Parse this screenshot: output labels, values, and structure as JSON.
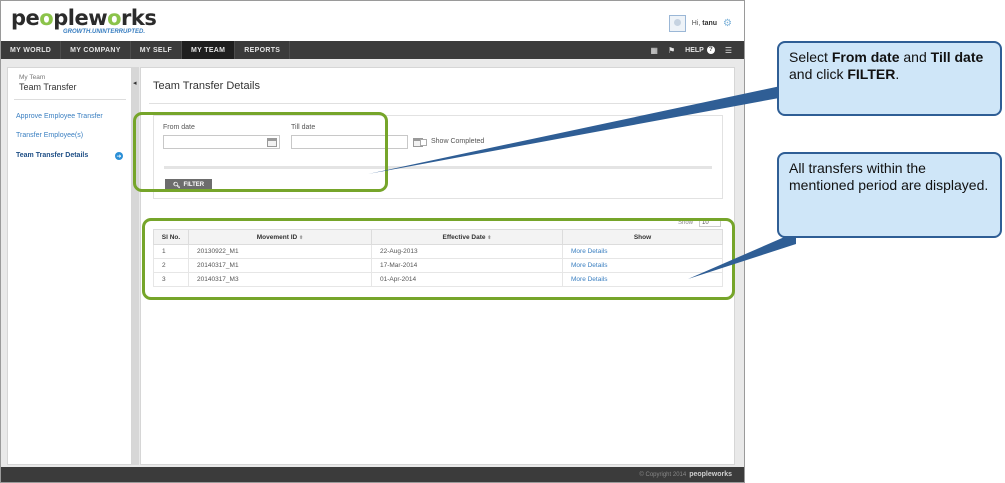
{
  "app": {
    "logo_text_1": "pe",
    "logo_text_2": "ple",
    "logo_text_3": "w",
    "logo_text_4": "rks",
    "tagline": "GROWTH.UNINTERRUPTED.",
    "greeting": "Hi,",
    "username": "tanu"
  },
  "nav": {
    "items": [
      {
        "label": "MY WORLD"
      },
      {
        "label": "MY COMPANY"
      },
      {
        "label": "MY SELF"
      },
      {
        "label": "MY TEAM"
      },
      {
        "label": "REPORTS"
      }
    ],
    "help": "HELP"
  },
  "sidebar": {
    "section": "My Team",
    "title": "Team Transfer",
    "links": [
      {
        "label": "Approve Employee Transfer"
      },
      {
        "label": "Transfer Employee(s)"
      },
      {
        "label": "Team Transfer Details"
      }
    ]
  },
  "main": {
    "title": "Team Transfer Details",
    "filter": {
      "from_label": "From date",
      "till_label": "Till date",
      "from_value": "",
      "till_value": "",
      "show_completed": "Show Completed",
      "button": "FILTER"
    },
    "show_label": "Show",
    "show_value": "10",
    "table": {
      "headers": [
        "Sl No.",
        "Movement ID",
        "Effective Date",
        "Show"
      ],
      "rows": [
        [
          "1",
          "20130922_M1",
          "22-Aug-2013",
          "More Details"
        ],
        [
          "2",
          "20140317_M1",
          "17-Mar-2014",
          "More Details"
        ],
        [
          "3",
          "20140317_M3",
          "01-Apr-2014",
          "More Details"
        ]
      ]
    }
  },
  "footer": {
    "copyright": "© Copyright 2014",
    "brand": "peopleworks"
  },
  "annotations": {
    "callout1_a": "Select ",
    "callout1_b": "From date",
    "callout1_c": " and ",
    "callout1_d": "Till date",
    "callout1_e": "  and click ",
    "callout1_f": "FILTER",
    "callout1_g": ".",
    "callout2": "All transfers within the mentioned period are displayed."
  },
  "colors": {
    "accent_green": "#76a52a",
    "nav_bg": "#3b3b3b",
    "link_blue": "#3a7fc1",
    "callout_bg": "#cfe6f8",
    "callout_border": "#2f5e95"
  }
}
